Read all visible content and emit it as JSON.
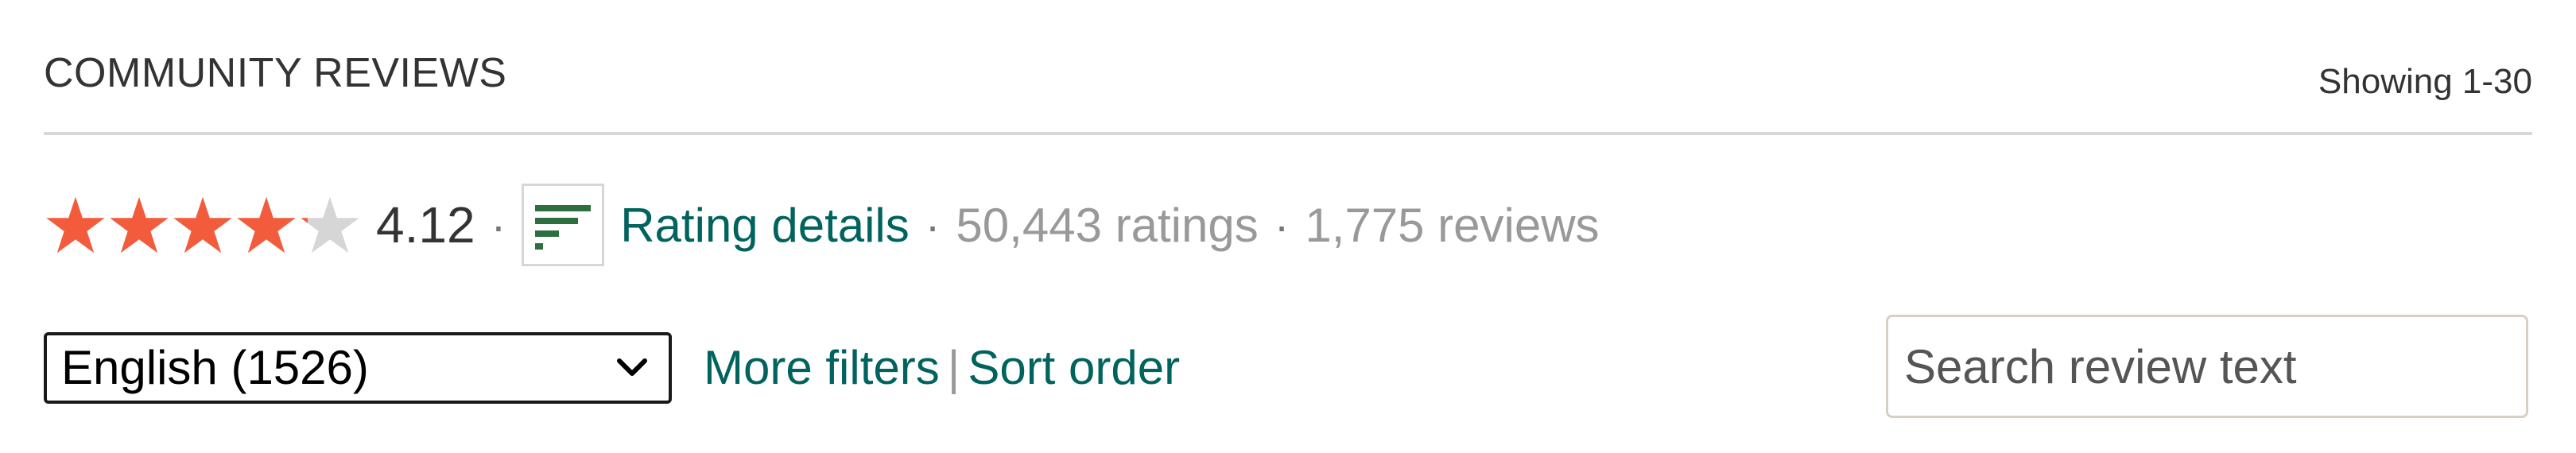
{
  "header": {
    "title": "COMMUNITY REVIEWS",
    "showing": "Showing 1-30"
  },
  "rating": {
    "stars_value": 4.12,
    "stars_max": 5,
    "average": "4.12",
    "separator": "·",
    "details_label": "Rating details",
    "ratings_count": "50,443 ratings",
    "reviews_count": "1,775 reviews",
    "star_color": "#f25c3c",
    "star_empty_color": "#d6d6d6"
  },
  "filters": {
    "language_selected": "English (1526)",
    "more_filters_label": "More filters",
    "divider": "|",
    "sort_order_label": "Sort order"
  },
  "search": {
    "placeholder": "Search review text"
  },
  "icons": {
    "graph": "rating-graph-icon",
    "search": "search-icon",
    "dropdown": "chevron-down-icon"
  }
}
